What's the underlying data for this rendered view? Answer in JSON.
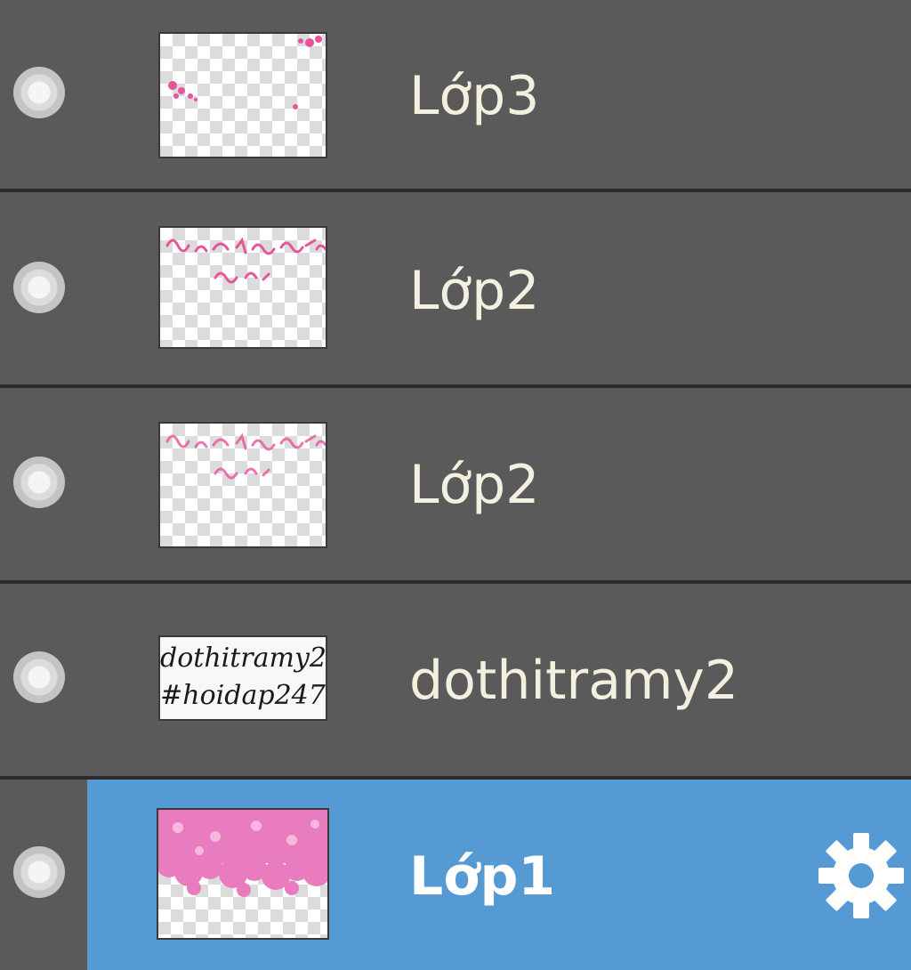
{
  "layers": [
    {
      "name": "Lớp3",
      "selected": false,
      "thumbnail": "pink-sparkle-corners"
    },
    {
      "name": "Lớp2",
      "selected": false,
      "thumbnail": "pink-handwriting"
    },
    {
      "name": "Lớp2",
      "selected": false,
      "thumbnail": "pink-handwriting"
    },
    {
      "name": "dothitramy2",
      "selected": false,
      "thumbnail": "black-text-watermark",
      "thumbnail_text": [
        "dothitramy2",
        "#hoidap247"
      ]
    },
    {
      "name": "Lớp1",
      "selected": true,
      "thumbnail": "pink-flowers-top"
    }
  ],
  "colors": {
    "panel_bg": "#5a5a5a",
    "divider": "#2b2b2b",
    "selected_bg": "#569ad4",
    "text": "#f4f0e0",
    "accent_pink": "#e9539a"
  },
  "icons": {
    "visibility": "eye-dot-icon",
    "settings": "gear-icon"
  }
}
